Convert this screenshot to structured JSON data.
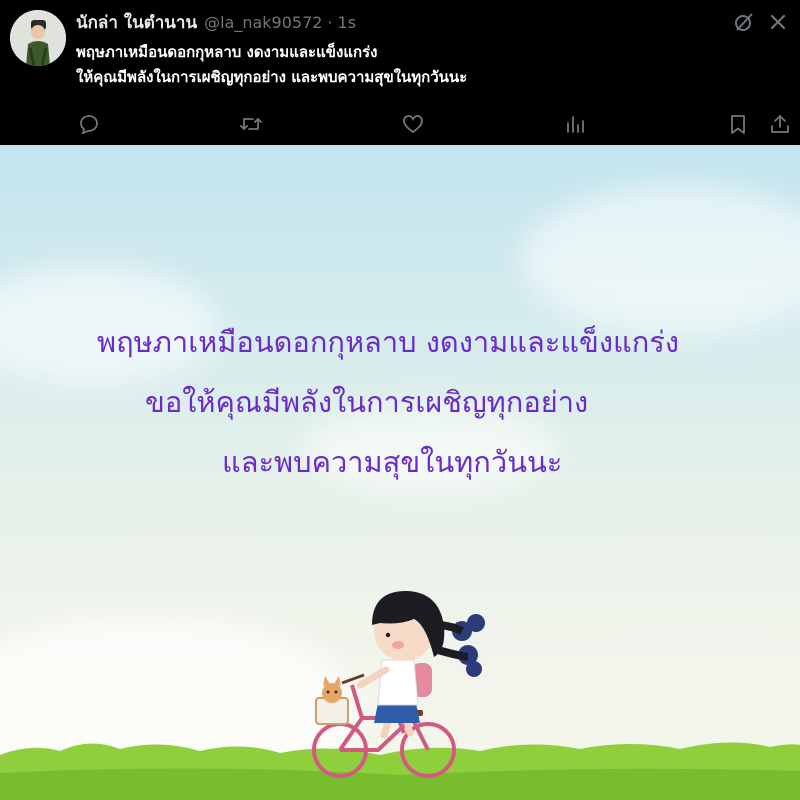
{
  "post": {
    "display_name": "นักล่า ในตำนาน",
    "handle": "@la_nak90572",
    "separator": "·",
    "time": "1s",
    "text_lines": [
      "พฤษภาเหมือนดอกกุหลาบ งดงามและแข็งแกร่ง",
      "ให้คุณมีพลังในการเผชิญทุกอย่าง และพบความสุขในทุกวันนะ"
    ],
    "icons": {
      "grok": "grok-icon",
      "more": "more-icon",
      "reply": "reply-icon",
      "repost": "repost-icon",
      "like": "like-icon",
      "views": "views-icon",
      "bookmark": "bookmark-icon",
      "share": "share-icon"
    }
  },
  "image": {
    "lines": [
      "พฤษภาเหมือนดอกกุหลาบ งดงามและแข็งแกร่ง",
      "ขอให้คุณมีพลังในการเผชิญทุกอย่าง",
      "และพบความสุขในทุกวันนะ"
    ],
    "text_color": "#6a2bc8"
  },
  "colors": {
    "background": "#000000",
    "icon_gray": "#71767b"
  }
}
